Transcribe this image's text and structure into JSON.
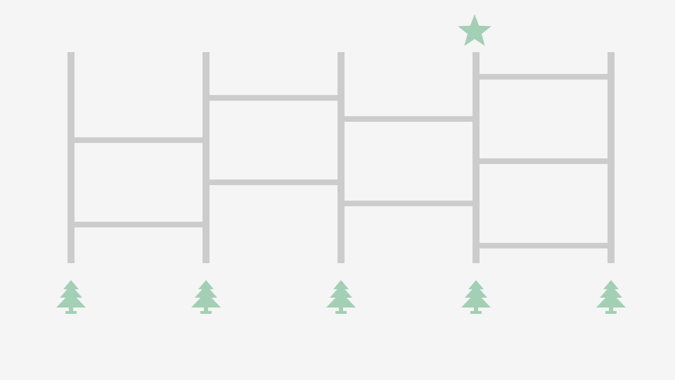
{
  "game": {
    "type": "ladder-lottery",
    "columns": 5,
    "top_marker": {
      "icon": "star-icon",
      "column": 3
    },
    "bottom_markers": [
      {
        "icon": "tree-icon",
        "column": 0
      },
      {
        "icon": "tree-icon",
        "column": 1
      },
      {
        "icon": "tree-icon",
        "column": 2
      },
      {
        "icon": "tree-icon",
        "column": 3
      },
      {
        "icon": "tree-icon",
        "column": 4
      }
    ],
    "rungs": [
      {
        "from": 0,
        "to": 1,
        "level": 0.417
      },
      {
        "from": 0,
        "to": 1,
        "level": 0.817
      },
      {
        "from": 1,
        "to": 2,
        "level": 0.217
      },
      {
        "from": 1,
        "to": 2,
        "level": 0.617
      },
      {
        "from": 2,
        "to": 3,
        "level": 0.317
      },
      {
        "from": 2,
        "to": 3,
        "level": 0.717
      },
      {
        "from": 3,
        "to": 4,
        "level": 0.117
      },
      {
        "from": 3,
        "to": 4,
        "level": 0.517
      },
      {
        "from": 3,
        "to": 4,
        "level": 0.917
      }
    ]
  },
  "colors": {
    "background": "#f5f5f5",
    "ladder": "#cccccc",
    "accent": "#a3cfb5"
  }
}
